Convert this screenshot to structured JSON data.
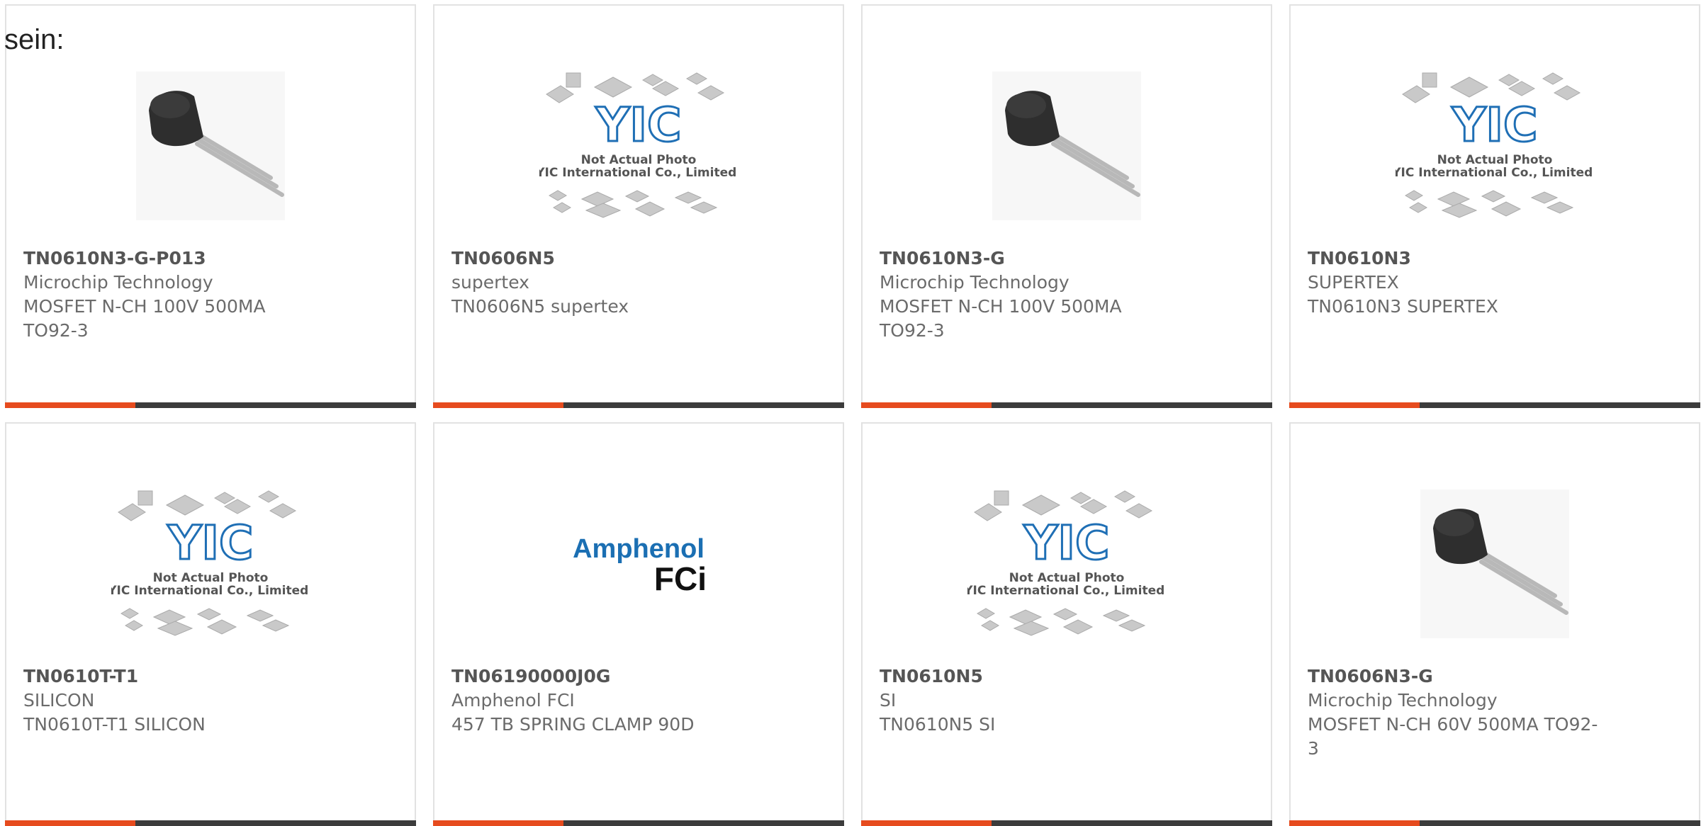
{
  "page": {
    "lead_text": "sein:"
  },
  "placeholder_photo": {
    "brand": "YIC",
    "line1": "Not Actual Photo",
    "line2": "YIC International Co., Limited."
  },
  "amphenol_logo": {
    "line1": "Amphenol",
    "line2": "FCi"
  },
  "colors": {
    "accent_bar": "#e64b1e",
    "bar": "#3c3c3c",
    "yic_blue": "#1f6fb5",
    "amphenol_blue": "#1b6fb3"
  },
  "products": [
    {
      "image": "to92-transistor-photo",
      "part_number": "TN0610N3-G-P013",
      "manufacturer": "Microchip Technology",
      "description_lines": [
        "MOSFET N-CH 100V 500MA",
        "TO92-3"
      ]
    },
    {
      "image": "yic-placeholder",
      "part_number": "TN0606N5",
      "manufacturer": "supertex",
      "description_lines": [
        "TN0606N5 supertex"
      ]
    },
    {
      "image": "to92-transistor-photo",
      "part_number": "TN0610N3-G",
      "manufacturer": "Microchip Technology",
      "description_lines": [
        "MOSFET N-CH 100V 500MA",
        "TO92-3"
      ]
    },
    {
      "image": "yic-placeholder",
      "part_number": "TN0610N3",
      "manufacturer": "SUPERTEX",
      "description_lines": [
        "TN0610N3 SUPERTEX"
      ]
    },
    {
      "image": "yic-placeholder",
      "part_number": "TN0610T-T1",
      "manufacturer": "SILICON",
      "description_lines": [
        "TN0610T-T1 SILICON"
      ]
    },
    {
      "image": "amphenol-fci-logo",
      "part_number": "TN06190000J0G",
      "manufacturer": "Amphenol FCI",
      "description_lines": [
        "457 TB SPRING CLAMP 90D"
      ]
    },
    {
      "image": "yic-placeholder",
      "part_number": "TN0610N5",
      "manufacturer": "SI",
      "description_lines": [
        "TN0610N5 SI"
      ]
    },
    {
      "image": "to92-transistor-photo",
      "part_number": "TN0606N3-G",
      "manufacturer": "Microchip Technology",
      "description_lines": [
        "MOSFET N-CH 60V 500MA TO92-",
        "3"
      ]
    }
  ]
}
